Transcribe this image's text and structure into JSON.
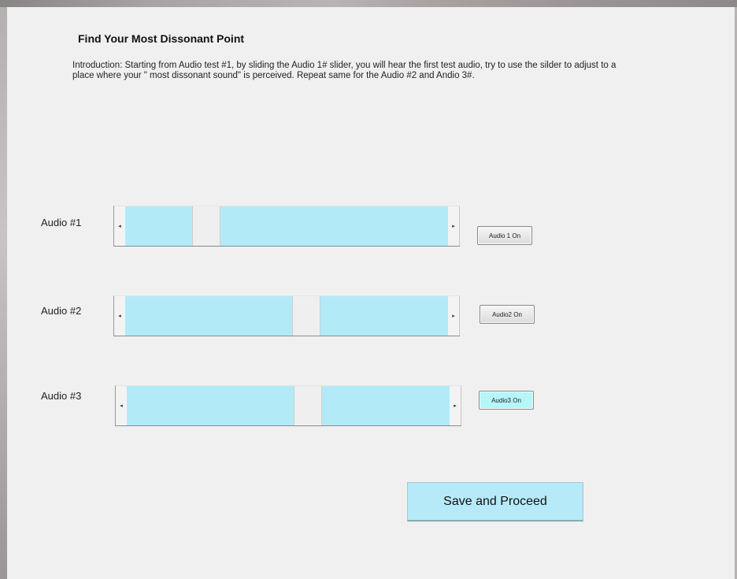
{
  "app": {
    "title": "Find Your Most Dissonant Point",
    "intro": "Introduction: Starting from Audio test #1, by  sliding the Audio 1# slider, you will hear the first test audio, try to use the silder to adjust to a place where your \" most dissonant sound\" is perceived. Repeat same for the Audio #2 and Andio 3#."
  },
  "sliders": [
    {
      "label": "Audio #1",
      "value_fraction": 0.25,
      "button_label": "Audio 1 On",
      "button_active": false
    },
    {
      "label": "Audio #2",
      "value_fraction": 0.56,
      "button_label": "Audio2 On",
      "button_active": false
    },
    {
      "label": "Audio #3",
      "value_fraction": 0.56,
      "button_label": "Audio3 On",
      "button_active": true
    }
  ],
  "save_button_label": "Save and Proceed",
  "colors": {
    "track": "#b3eaf8",
    "active_button": "#b5f6fb",
    "save_button": "#b6eaf8",
    "background": "#f0f0f0"
  },
  "icons": {
    "left_arrow": "◂",
    "right_arrow": "▸"
  }
}
